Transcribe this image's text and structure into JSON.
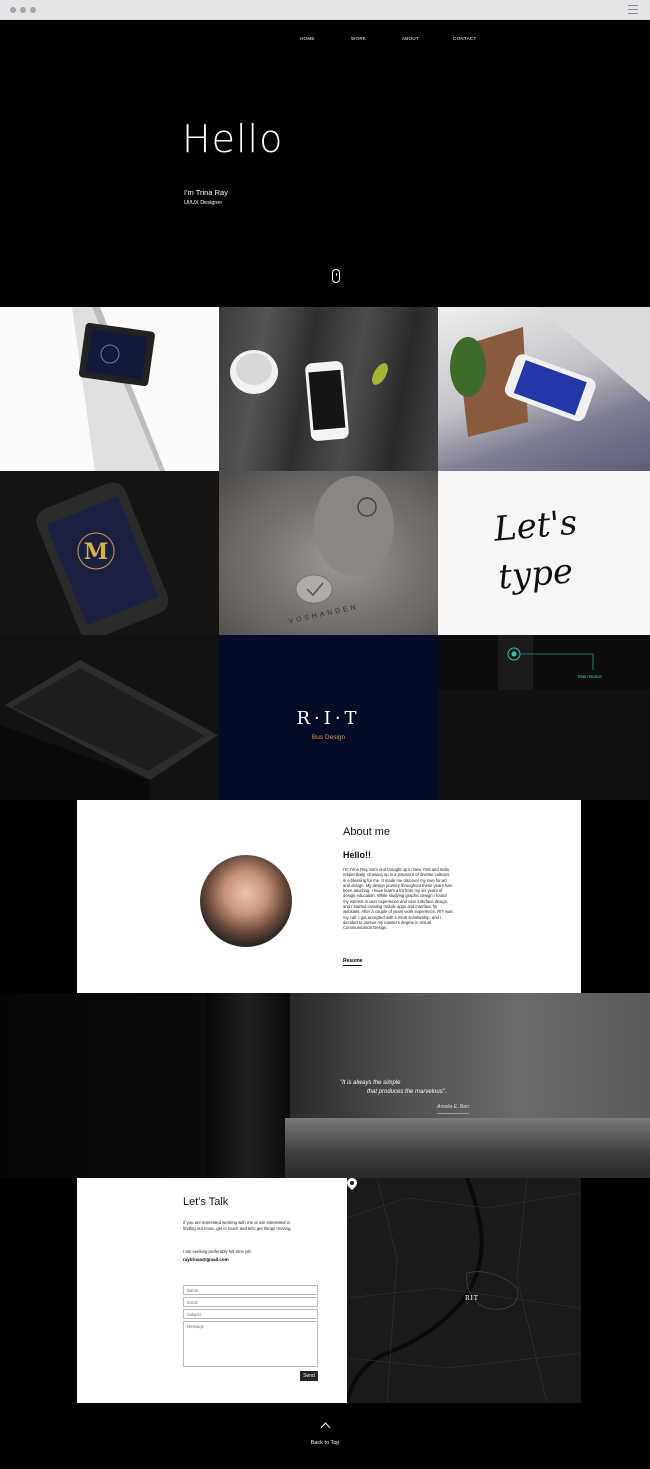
{
  "nav": {
    "home": "HOME",
    "work": "WORK",
    "about": "ABOUT",
    "contact": "CONTACT"
  },
  "hero": {
    "greeting": "Hello",
    "name": "I'm Trina Ray",
    "role": "UI/UX Designer"
  },
  "portfolio": {
    "rit_title": "R·I·T",
    "rit_subtitle": "Bus Design",
    "lets_type": "Let's type",
    "main_button_label": "Main Button"
  },
  "about": {
    "title": "About me",
    "hello": "Hello!!",
    "body": "I'm Trina Ray, born and brought up in New York and India respectively. Growing up in a potpourri of diverse cultures is a blessing for me. It made me discover my love for art and design. My design journey throughout these years has been amazing. I have learnt a lot from my six years of design education. While studying graphic design I found my interest in user experience and user interface design, and I started creating mobile apps and interface for websites. After a couple of years work experience, RIT was my call. I got accepted with a merit scholarship, and I decided to pursue my master's degree in Visual Communication Design.",
    "resume": "Resume"
  },
  "quote": {
    "line1": "\"It is always the simple",
    "line2": "that produces the marvelous\".",
    "author": "Amelia E. Barr"
  },
  "contact": {
    "title": "Let's Talk",
    "text": "If you are interested working with me or are interested in finding out more, get in touch and let's get things moving.",
    "availability": "I am seeking preferably full-time job.",
    "email": "raytrinaa@gmail.com",
    "name_placeholder": "Name",
    "email_placeholder": "Email",
    "subject_placeholder": "Subject",
    "message_placeholder": "Message",
    "send": "Send"
  },
  "map": {
    "label": "RIT"
  },
  "footer": {
    "back_to_top": "Back to Top"
  },
  "colors": {
    "accent_gold": "#d39a3d",
    "accent_teal": "#2ec5b3",
    "rit_navy": "#050c26"
  }
}
